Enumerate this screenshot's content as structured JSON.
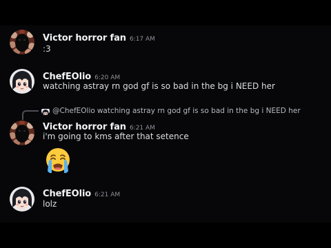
{
  "messages": [
    {
      "username": "Victor horror fan",
      "timestamp": "6:17 AM",
      "text": ":3",
      "avatar_icon": "black-shadow-creature-avatar-icon"
    },
    {
      "username": "ChefEOlio",
      "timestamp": "6:20 AM",
      "text": "watching astray rn god gf is so bad in the bg i NEED her",
      "avatar_icon": "anime-girl-avatar-icon"
    },
    {
      "reply": {
        "mention": "@ChefEOlio",
        "text": "watching astray rn god gf is so bad in the bg i NEED her"
      },
      "username": "Victor horror fan",
      "timestamp": "6:21 AM",
      "text": "i'm going to kms after that setence",
      "emoji": "loudly-crying-face-emoji",
      "avatar_icon": "black-shadow-creature-avatar-icon"
    },
    {
      "username": "ChefEOlio",
      "timestamp": "6:21 AM",
      "text": "lolz",
      "avatar_icon": "anime-girl-avatar-icon"
    }
  ],
  "colors": {
    "background": "#070709",
    "letterbox": "#000000",
    "username": "#f2f3f5",
    "message_text": "#dbdee1",
    "timestamp": "#8e9099",
    "reply_text": "#b5bac1"
  }
}
